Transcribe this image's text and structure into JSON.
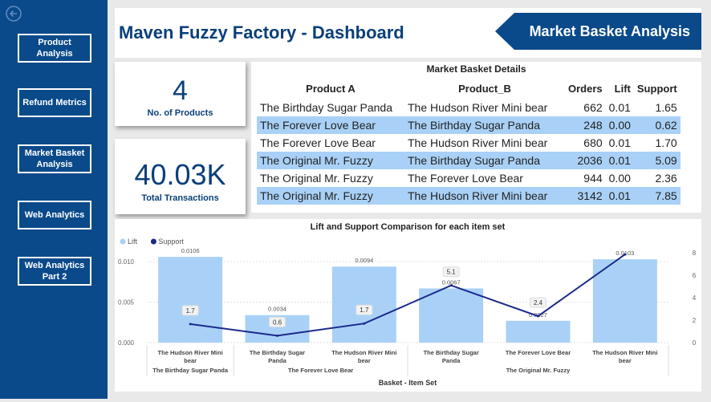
{
  "nav": {
    "back_icon": "back-arrow-icon",
    "items": [
      {
        "label": "Product Analysis"
      },
      {
        "label": "Refund Metrics"
      },
      {
        "label": "Market Basket Analysis"
      },
      {
        "label": "Web Analytics"
      },
      {
        "label": "Web Analytics Part 2"
      }
    ]
  },
  "header": {
    "title": "Maven Fuzzy Factory - Dashboard",
    "banner": "Market Basket Analysis"
  },
  "kpis": {
    "products": {
      "value": "4",
      "label": "No. of Products"
    },
    "transactions": {
      "value": "40.03K",
      "label": "Total Transactions"
    }
  },
  "table": {
    "title": "Market Basket Details",
    "headers": [
      "Product A",
      "Product_B",
      "Orders",
      "Lift",
      "Support"
    ],
    "rows": [
      [
        "The Birthday Sugar Panda",
        "The Hudson River Mini bear",
        "662",
        "0.01",
        "1.65"
      ],
      [
        "The Forever Love Bear",
        "The Birthday Sugar Panda",
        "248",
        "0.00",
        "0.62"
      ],
      [
        "The Forever Love Bear",
        "The Hudson River Mini bear",
        "680",
        "0.01",
        "1.70"
      ],
      [
        "The Original Mr. Fuzzy",
        "The Birthday Sugar Panda",
        "2036",
        "0.01",
        "5.09"
      ],
      [
        "The Original Mr. Fuzzy",
        "The Forever Love Bear",
        "944",
        "0.00",
        "2.36"
      ],
      [
        "The Original Mr. Fuzzy",
        "The Hudson River Mini bear",
        "3142",
        "0.01",
        "7.85"
      ]
    ]
  },
  "colors": {
    "accent": "#0a4a8a",
    "lift": "#a9d1f7",
    "support": "#1a2a8c"
  },
  "chart_data": {
    "type": "bar",
    "title": "Lift and Support Comparison for each item set",
    "xlabel": "Basket - Item Set",
    "legend": [
      {
        "name": "Lift",
        "color": "#a9d1f7"
      },
      {
        "name": "Support",
        "color": "#1a2a8c"
      }
    ],
    "legend_position": "top-left",
    "categories": [
      [
        "The Hudson River Mini",
        "bear"
      ],
      [
        "The Birthday Sugar",
        "Panda"
      ],
      [
        "The Hudson River Mini",
        "bear"
      ],
      [
        "The Birthday Sugar",
        "Panda"
      ],
      [
        "The Forever Love Bear"
      ],
      [
        "The Hudson River Mini",
        "bear"
      ]
    ],
    "groups": [
      {
        "label": "The Birthday Sugar Panda",
        "span": [
          0,
          0
        ]
      },
      {
        "label": "The Forever Love Bear",
        "span": [
          1,
          2
        ]
      },
      {
        "label": "The Original Mr. Fuzzy",
        "span": [
          3,
          5
        ]
      }
    ],
    "series": [
      {
        "name": "Lift",
        "type": "bar",
        "axis": "left",
        "values": [
          0.0106,
          0.0034,
          0.0094,
          0.0067,
          0.0027,
          0.0103
        ],
        "labels": [
          "0.0106",
          "0.0034",
          "0.0094",
          "0.0067",
          "0.0027",
          "0.0103"
        ]
      },
      {
        "name": "Support",
        "type": "line",
        "axis": "right",
        "values": [
          1.65,
          0.62,
          1.7,
          5.09,
          2.36,
          7.85
        ],
        "labels": [
          "1.7",
          "0.6",
          "1.7",
          "5.1",
          "2.4",
          ""
        ]
      }
    ],
    "y_left": {
      "ticks": [
        "0.000",
        "0.005",
        "0.010"
      ],
      "tick_values": [
        0,
        0.005,
        0.01
      ],
      "range": [
        0,
        0.0123
      ]
    },
    "y_right": {
      "ticks": [
        "0",
        "2",
        "4",
        "6",
        "8"
      ],
      "tick_values": [
        0,
        2,
        4,
        6,
        8
      ],
      "range": [
        0,
        8
      ]
    }
  }
}
